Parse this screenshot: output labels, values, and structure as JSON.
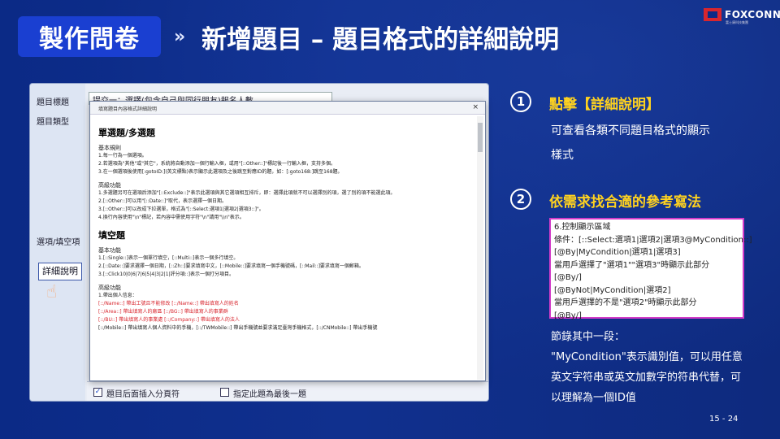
{
  "header": {
    "section_label": "製作問卷",
    "chevron": "»",
    "title": "新增題目 – 題目格式的詳細說明",
    "logo_text": "FOXCONN",
    "logo_sub": "富士康科技集團",
    "colors": {
      "background": "#0b2a86",
      "pill": "#1a3fd1",
      "accent_yellow": "#ffd21f",
      "brand_red": "#d8262e",
      "example_border": "#d23bc8"
    }
  },
  "form": {
    "labels": {
      "title": "題目標題",
      "type": "題目類型",
      "options": "選項/填空項"
    },
    "title_value": "提交一：選擇(包含自己與同行朋友)報名人數",
    "detail_button": "詳細說明",
    "hand_icon": "pointing-hand-icon",
    "bottom": {
      "cb1_label": "題目后面插入分頁符",
      "cb2_label": "指定此題為最後一題"
    }
  },
  "dialog": {
    "title": "填寫題目內容格式詳細說明",
    "close_label": "×",
    "sections": [
      {
        "heading": "單選題/多選題",
        "blocks": [
          {
            "sub": "基本規則",
            "lines": [
              "1.每一行為一個選項。",
              "2.若選項為\"其他\"或\"其它\"，系統將自動添加一個行輸入框，或用\"[::Other::]\"標記後一行輸入框，支持多個。",
              "3.在一個選項後使用[:gotoID:](英文標點)表示顯示此選項及之後跳至對應ID的題，如：[:goto168:]跳至168題。"
            ]
          },
          {
            "sub": "高級功能",
            "lines": [
              "1.多選題另可在選項后添加\"[::Exclude::]\"表示此選項與其它選項相互排斥，即：選擇此項就不可以選擇別的項，選了別的項不能選此項。",
              "2.[::Other::]可以用\"[::Date::]\"取代，表示選擇一個日期。",
              "3.[::Other::]可以改成下拉選單，格式為\"[::Select:選項1|選項2|選項3::]\"。",
              "4.換行內容使用\"\\n\"標記，若內容中需使用字符\"\\n\"請用\"\\\\n\"表示。"
            ]
          }
        ]
      },
      {
        "heading": "填空題",
        "blocks": [
          {
            "sub": "基本功能",
            "lines": [
              "1.[::Single::]表示一個單行填空，[::Multi::]表示一個多行填空。",
              "2.[::Date::]要求選擇一個日期，[::Zh::]要求填寫中文，[::Mobile::]要求填寫一個手機號碼，[::Mail::]要求填寫一個郵箱。",
              "3.[::Click10|0|6|7|6|5|4|3|2|1|評分項::]表示一個打分項目。"
            ]
          },
          {
            "sub": "高級功能",
            "lines": [
              "1.帶出個人信息：",
              "[::/Name::] 帶出工號且不能修改    [::/Name::] 帶出填寫人的姓名",
              "[::/Area::] 帶出填寫人的廠區      [::/BG::] 帶出填寫人的事業群",
              "[::/BU::] 帶出填寫人的事業處      [::/Company::] 帶出填寫人的法人",
              "[::/Mobile::] 帶出填寫人個人資料中的手機，[::/TWMobile::] 帶出手機號並要求滿足臺灣手機格式，[::/CNMobile::] 帶出手機號"
            ]
          }
        ]
      }
    ]
  },
  "right": {
    "step1": {
      "number": "1",
      "title": "點擊【詳細說明】",
      "desc_lines": [
        "可查看各類不同題目格式的顯示",
        "樣式"
      ]
    },
    "step2": {
      "number": "2",
      "title": "依需求找合適的參考寫法"
    },
    "example_lines": [
      "6.控制顯示區域",
      "條件：[::Select:選項1|選項2|選項3@MyCondition::]",
      "[@By|MyCondition|選項1|選項3]",
      "當用戶選擇了\"選項1\"\"選項3\"時顯示此部分",
      "[@By/]",
      "[@ByNot|MyCondition|選項2]",
      "當用戶選擇的不是\"選項2\"時顯示此部分",
      "[@By/]"
    ],
    "note_lines": [
      "節錄其中一段：",
      "\"MyCondition\"表示識別值，可以用任意",
      "英文字符串或英文加數字的符串代替，可",
      "以理解為一個ID值"
    ]
  },
  "page_number": "15 - 24"
}
